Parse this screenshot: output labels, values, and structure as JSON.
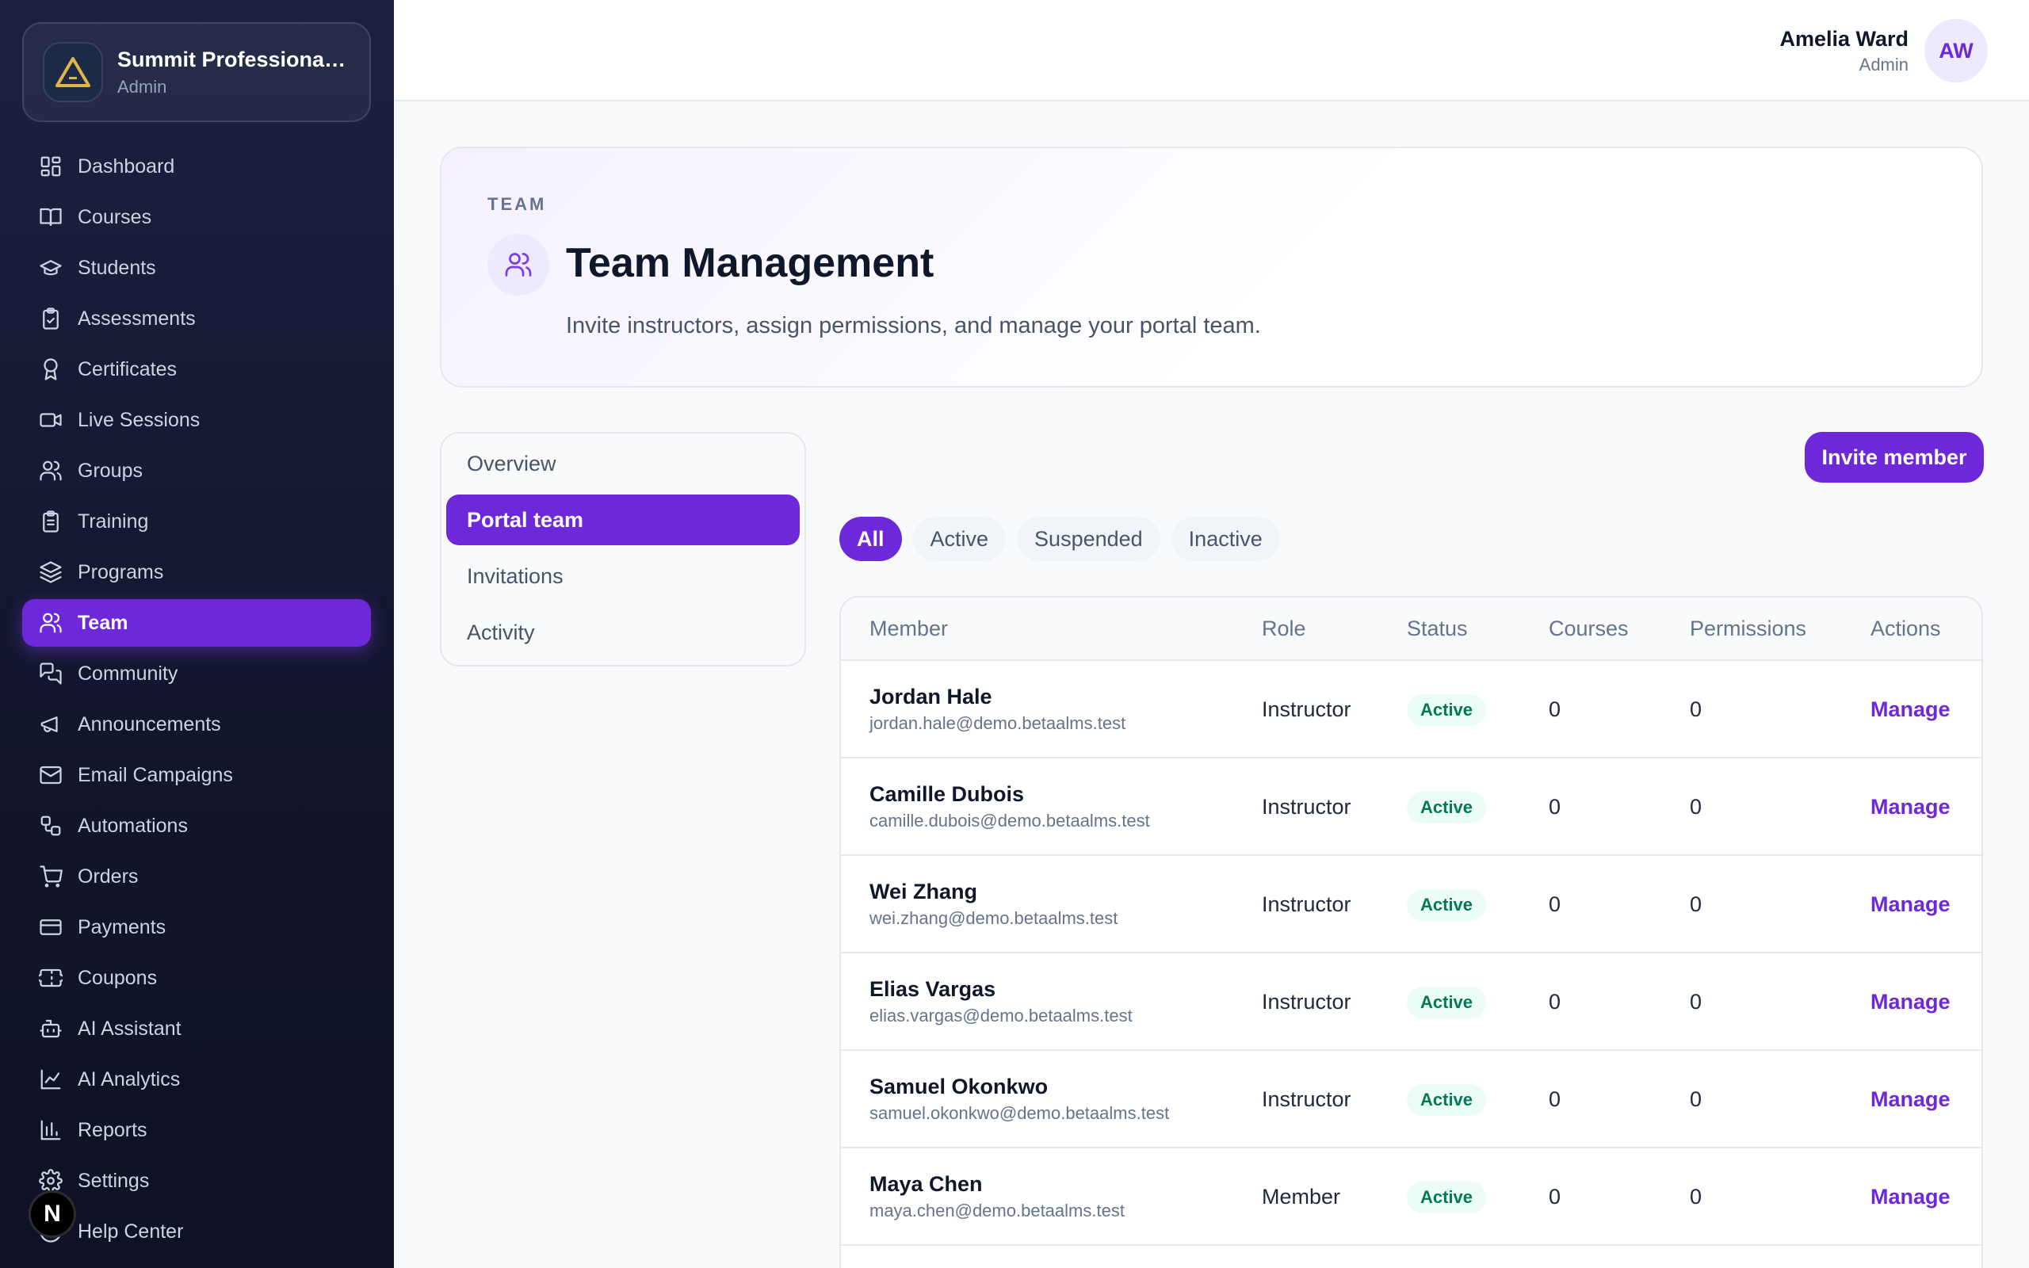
{
  "org": {
    "name": "Summit Professional Academy",
    "role": "Admin"
  },
  "sidebar": {
    "items": [
      {
        "label": "Dashboard",
        "icon": "dashboard-icon"
      },
      {
        "label": "Courses",
        "icon": "book-icon"
      },
      {
        "label": "Students",
        "icon": "graduation-cap-icon"
      },
      {
        "label": "Assessments",
        "icon": "clipboard-check-icon"
      },
      {
        "label": "Certificates",
        "icon": "award-icon"
      },
      {
        "label": "Live Sessions",
        "icon": "video-icon"
      },
      {
        "label": "Groups",
        "icon": "users-icon"
      },
      {
        "label": "Training",
        "icon": "clipboard-list-icon"
      },
      {
        "label": "Programs",
        "icon": "layers-icon"
      },
      {
        "label": "Team",
        "icon": "team-icon",
        "active": true
      },
      {
        "label": "Community",
        "icon": "chat-icon"
      },
      {
        "label": "Announcements",
        "icon": "megaphone-icon"
      },
      {
        "label": "Email Campaigns",
        "icon": "mail-icon"
      },
      {
        "label": "Automations",
        "icon": "workflow-icon"
      },
      {
        "label": "Orders",
        "icon": "cart-icon"
      },
      {
        "label": "Payments",
        "icon": "credit-card-icon"
      },
      {
        "label": "Coupons",
        "icon": "ticket-icon"
      },
      {
        "label": "AI Assistant",
        "icon": "bot-icon"
      },
      {
        "label": "AI Analytics",
        "icon": "line-chart-icon"
      },
      {
        "label": "Reports",
        "icon": "bar-chart-icon"
      },
      {
        "label": "Settings",
        "icon": "gear-icon"
      },
      {
        "label": "Help Center",
        "icon": "help-icon"
      }
    ]
  },
  "badge": {
    "letter": "N"
  },
  "user": {
    "name": "Amelia Ward",
    "role": "Admin",
    "initials": "AW"
  },
  "header": {
    "eyebrow": "TEAM",
    "title": "Team Management",
    "subtitle": "Invite instructors, assign permissions, and manage your portal team."
  },
  "subnav": {
    "items": [
      {
        "label": "Overview"
      },
      {
        "label": "Portal team",
        "active": true
      },
      {
        "label": "Invitations"
      },
      {
        "label": "Activity"
      }
    ]
  },
  "invite_label": "Invite member",
  "filters": {
    "items": [
      {
        "label": "All",
        "active": true
      },
      {
        "label": "Active"
      },
      {
        "label": "Suspended"
      },
      {
        "label": "Inactive"
      }
    ]
  },
  "table": {
    "headers": [
      "Member",
      "Role",
      "Status",
      "Courses",
      "Permissions",
      "Actions"
    ],
    "rows": [
      {
        "name": "Jordan Hale",
        "email": "jordan.hale@demo.betaalms.test",
        "role": "Instructor",
        "status": "Active",
        "courses": "0",
        "permissions": "0",
        "action": "Manage"
      },
      {
        "name": "Camille Dubois",
        "email": "camille.dubois@demo.betaalms.test",
        "role": "Instructor",
        "status": "Active",
        "courses": "0",
        "permissions": "0",
        "action": "Manage"
      },
      {
        "name": "Wei Zhang",
        "email": "wei.zhang@demo.betaalms.test",
        "role": "Instructor",
        "status": "Active",
        "courses": "0",
        "permissions": "0",
        "action": "Manage"
      },
      {
        "name": "Elias Vargas",
        "email": "elias.vargas@demo.betaalms.test",
        "role": "Instructor",
        "status": "Active",
        "courses": "0",
        "permissions": "0",
        "action": "Manage"
      },
      {
        "name": "Samuel Okonkwo",
        "email": "samuel.okonkwo@demo.betaalms.test",
        "role": "Instructor",
        "status": "Active",
        "courses": "0",
        "permissions": "0",
        "action": "Manage"
      },
      {
        "name": "Maya Chen",
        "email": "maya.chen@demo.betaalms.test",
        "role": "Member",
        "status": "Active",
        "courses": "0",
        "permissions": "0",
        "action": "Manage"
      }
    ]
  },
  "colors": {
    "accent": "#6d28d9",
    "sidebar_bg": "#14172e",
    "status_active_bg": "#ecfdf5",
    "status_active_text": "#047857"
  }
}
